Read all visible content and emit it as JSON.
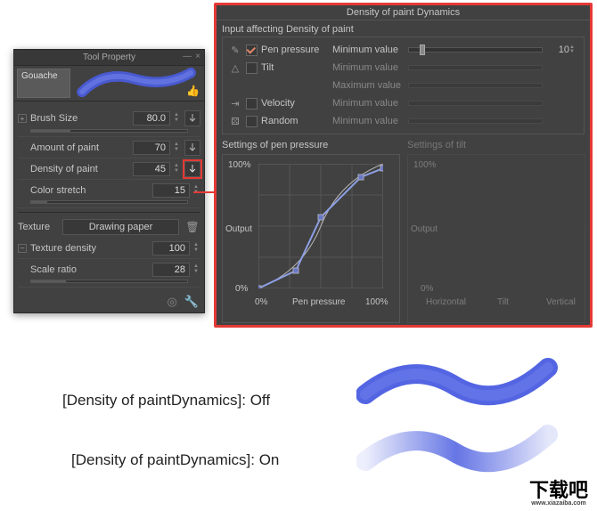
{
  "tool_panel": {
    "title": "Tool Property",
    "brush_name": "Gouache",
    "brush_size": {
      "label": "Brush Size",
      "value": "80.0"
    },
    "amount": {
      "label": "Amount of paint",
      "value": "70"
    },
    "density": {
      "label": "Density of paint",
      "value": "45"
    },
    "color_stretch": {
      "label": "Color stretch",
      "value": "15"
    },
    "texture": {
      "label": "Texture",
      "name": "Drawing paper"
    },
    "texture_density": {
      "label": "Texture density",
      "value": "100"
    },
    "scale": {
      "label": "Scale ratio",
      "value": "28"
    }
  },
  "dynamics": {
    "title": "Density of paint Dynamics",
    "section": "Input affecting Density of paint",
    "factors": {
      "pen": {
        "label": "Pen pressure",
        "min_label": "Minimum value",
        "min_value": "10"
      },
      "tilt": {
        "label": "Tilt",
        "min_label": "Minimum value",
        "max_label": "Maximum value"
      },
      "vel": {
        "label": "Velocity",
        "min_label": "Minimum value"
      },
      "rand": {
        "label": "Random",
        "min_label": "Minimum value"
      }
    },
    "curve": {
      "title": "Settings of pen pressure",
      "y_top": "100%",
      "y_mid": "Output",
      "y_bot": "0%",
      "x_left": "0%",
      "x_mid": "Pen pressure",
      "x_right": "100%"
    },
    "tilt_settings": {
      "title": "Settings of tilt",
      "y_top": "100%",
      "y_mid": "Output",
      "y_bot": "0%",
      "x_left": "Horizontal",
      "x_mid": "Tilt",
      "x_right": "Vertical"
    }
  },
  "captions": {
    "off": "[Density of paintDynamics]: Off",
    "on": "[Density of paintDynamics]: On"
  },
  "watermark": {
    "main": "下载吧",
    "sub": "www.xiazaiba.com"
  },
  "colors": {
    "accent": "#e53935",
    "brush_blue": "#4a5de0"
  }
}
